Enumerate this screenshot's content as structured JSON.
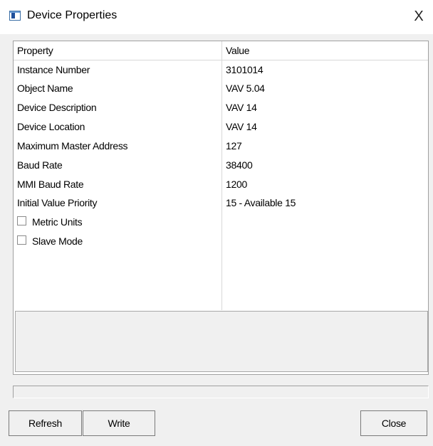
{
  "window": {
    "title": "Device Properties",
    "close_glyph": "X",
    "icon": "app-window-icon"
  },
  "table": {
    "headers": {
      "property": "Property",
      "value": "Value"
    },
    "rows": [
      {
        "property": "Instance Number",
        "value": "3101014"
      },
      {
        "property": "Object Name",
        "value": "VAV 5.04"
      },
      {
        "property": "Device Description",
        "value": "VAV 14"
      },
      {
        "property": "Device Location",
        "value": "VAV 14"
      },
      {
        "property": "Maximum Master Address",
        "value": "127"
      },
      {
        "property": "Baud Rate",
        "value": "38400"
      },
      {
        "property": "MMI Baud Rate",
        "value": "1200"
      },
      {
        "property": "Initial Value Priority",
        "value": "15 - Available 15"
      }
    ],
    "checkboxes": [
      {
        "label": "Metric Units",
        "checked": false
      },
      {
        "label": "Slave Mode",
        "checked": false
      }
    ]
  },
  "buttons": {
    "refresh": "Refresh",
    "write": "Write",
    "close": "Close"
  }
}
